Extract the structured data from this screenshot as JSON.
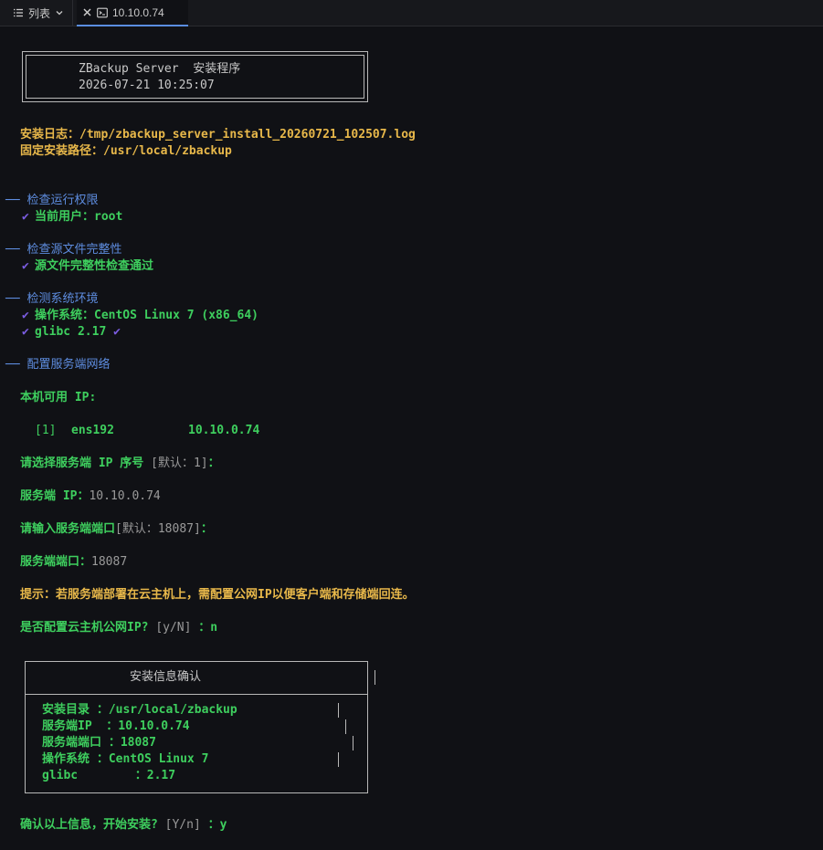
{
  "tabs": {
    "list_label": "列表",
    "active_label": "10.10.0.74"
  },
  "banner": {
    "title": "ZBackup Server  安装程序",
    "datetime": "2026-07-21 10:25:07"
  },
  "install_log": "安装日志：/tmp/zbackup_server_install_20260721_102507.log",
  "install_path": "固定安装路径：/usr/local/zbackup",
  "sections": {
    "check_permission": "── 检查运行权限",
    "current_user": "当前用户：root",
    "check_source": "── 检查源文件完整性",
    "source_ok": "源文件完整性检查通过",
    "check_env": "── 检测系统环境",
    "os": "操作系统：CentOS Linux 7 (x86_64)",
    "glibc": "glibc 2.17",
    "config_network": "── 配置服务端网络"
  },
  "network": {
    "available_ip_label": "本机可用 IP:",
    "iface_index": "[1]",
    "iface_name": "ens192",
    "iface_ip": "10.10.0.74",
    "select_prompt": "请选择服务端 IP 序号",
    "select_default": "[默认：1]",
    "select_colon": "：",
    "server_ip_label": "服务端 IP：",
    "server_ip_value": "10.10.0.74",
    "port_prompt": "请输入服务端端口",
    "port_default": "[默认：18087]",
    "port_colon": "：",
    "server_port_label": "服务端端口：",
    "server_port_value": "18087",
    "hint": "提示：若服务端部署在云主机上，需配置公网IP以便客户端和存储端回连。",
    "public_ip_prompt": "是否配置云主机公网IP?",
    "public_ip_choice": "[y/N]",
    "public_ip_answer": "：n"
  },
  "confirm_box": {
    "title": "安装信息确认",
    "rows": [
      "安装目录 ：/usr/local/zbackup",
      "服务端IP  ：10.10.0.74",
      "服务端端口 ：18087",
      "操作系统 ：CentOS Linux 7",
      "glibc        ：2.17"
    ]
  },
  "final": {
    "prompt": "确认以上信息，开始安装?",
    "choice": "[Y/n]",
    "answer": "：y"
  },
  "colors": {
    "background": "#101115",
    "yellow": "#e8b84a",
    "green": "#3ecf5e",
    "blue": "#5e8de0",
    "check": "#7a5ce0"
  },
  "icons": {
    "list": "list-icon",
    "chevron": "chevron-down-icon",
    "close": "close-icon",
    "terminal": "terminal-icon",
    "check": "check-icon"
  }
}
